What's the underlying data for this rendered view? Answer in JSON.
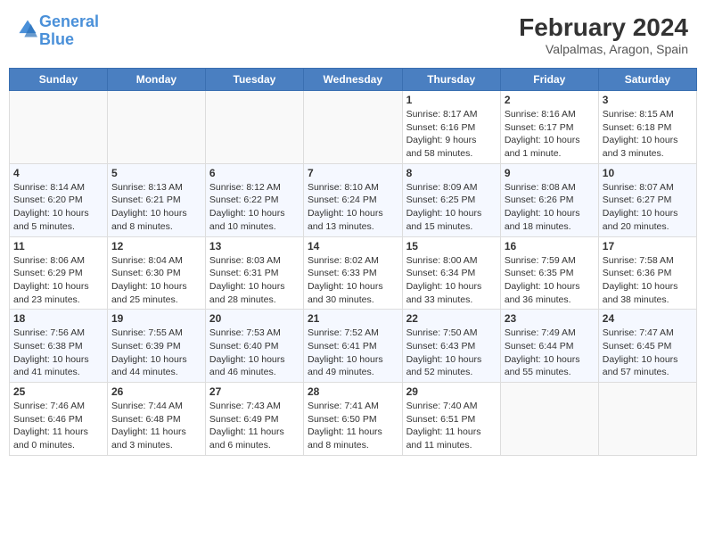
{
  "header": {
    "logo_text_general": "General",
    "logo_text_blue": "Blue",
    "month_title": "February 2024",
    "location": "Valpalmas, Aragon, Spain"
  },
  "days_of_week": [
    "Sunday",
    "Monday",
    "Tuesday",
    "Wednesday",
    "Thursday",
    "Friday",
    "Saturday"
  ],
  "weeks": [
    [
      {
        "date": "",
        "lines": []
      },
      {
        "date": "",
        "lines": []
      },
      {
        "date": "",
        "lines": []
      },
      {
        "date": "",
        "lines": []
      },
      {
        "date": "1",
        "lines": [
          "Sunrise: 8:17 AM",
          "Sunset: 6:16 PM",
          "Daylight: 9 hours",
          "and 58 minutes."
        ]
      },
      {
        "date": "2",
        "lines": [
          "Sunrise: 8:16 AM",
          "Sunset: 6:17 PM",
          "Daylight: 10 hours",
          "and 1 minute."
        ]
      },
      {
        "date": "3",
        "lines": [
          "Sunrise: 8:15 AM",
          "Sunset: 6:18 PM",
          "Daylight: 10 hours",
          "and 3 minutes."
        ]
      }
    ],
    [
      {
        "date": "4",
        "lines": [
          "Sunrise: 8:14 AM",
          "Sunset: 6:20 PM",
          "Daylight: 10 hours",
          "and 5 minutes."
        ]
      },
      {
        "date": "5",
        "lines": [
          "Sunrise: 8:13 AM",
          "Sunset: 6:21 PM",
          "Daylight: 10 hours",
          "and 8 minutes."
        ]
      },
      {
        "date": "6",
        "lines": [
          "Sunrise: 8:12 AM",
          "Sunset: 6:22 PM",
          "Daylight: 10 hours",
          "and 10 minutes."
        ]
      },
      {
        "date": "7",
        "lines": [
          "Sunrise: 8:10 AM",
          "Sunset: 6:24 PM",
          "Daylight: 10 hours",
          "and 13 minutes."
        ]
      },
      {
        "date": "8",
        "lines": [
          "Sunrise: 8:09 AM",
          "Sunset: 6:25 PM",
          "Daylight: 10 hours",
          "and 15 minutes."
        ]
      },
      {
        "date": "9",
        "lines": [
          "Sunrise: 8:08 AM",
          "Sunset: 6:26 PM",
          "Daylight: 10 hours",
          "and 18 minutes."
        ]
      },
      {
        "date": "10",
        "lines": [
          "Sunrise: 8:07 AM",
          "Sunset: 6:27 PM",
          "Daylight: 10 hours",
          "and 20 minutes."
        ]
      }
    ],
    [
      {
        "date": "11",
        "lines": [
          "Sunrise: 8:06 AM",
          "Sunset: 6:29 PM",
          "Daylight: 10 hours",
          "and 23 minutes."
        ]
      },
      {
        "date": "12",
        "lines": [
          "Sunrise: 8:04 AM",
          "Sunset: 6:30 PM",
          "Daylight: 10 hours",
          "and 25 minutes."
        ]
      },
      {
        "date": "13",
        "lines": [
          "Sunrise: 8:03 AM",
          "Sunset: 6:31 PM",
          "Daylight: 10 hours",
          "and 28 minutes."
        ]
      },
      {
        "date": "14",
        "lines": [
          "Sunrise: 8:02 AM",
          "Sunset: 6:33 PM",
          "Daylight: 10 hours",
          "and 30 minutes."
        ]
      },
      {
        "date": "15",
        "lines": [
          "Sunrise: 8:00 AM",
          "Sunset: 6:34 PM",
          "Daylight: 10 hours",
          "and 33 minutes."
        ]
      },
      {
        "date": "16",
        "lines": [
          "Sunrise: 7:59 AM",
          "Sunset: 6:35 PM",
          "Daylight: 10 hours",
          "and 36 minutes."
        ]
      },
      {
        "date": "17",
        "lines": [
          "Sunrise: 7:58 AM",
          "Sunset: 6:36 PM",
          "Daylight: 10 hours",
          "and 38 minutes."
        ]
      }
    ],
    [
      {
        "date": "18",
        "lines": [
          "Sunrise: 7:56 AM",
          "Sunset: 6:38 PM",
          "Daylight: 10 hours",
          "and 41 minutes."
        ]
      },
      {
        "date": "19",
        "lines": [
          "Sunrise: 7:55 AM",
          "Sunset: 6:39 PM",
          "Daylight: 10 hours",
          "and 44 minutes."
        ]
      },
      {
        "date": "20",
        "lines": [
          "Sunrise: 7:53 AM",
          "Sunset: 6:40 PM",
          "Daylight: 10 hours",
          "and 46 minutes."
        ]
      },
      {
        "date": "21",
        "lines": [
          "Sunrise: 7:52 AM",
          "Sunset: 6:41 PM",
          "Daylight: 10 hours",
          "and 49 minutes."
        ]
      },
      {
        "date": "22",
        "lines": [
          "Sunrise: 7:50 AM",
          "Sunset: 6:43 PM",
          "Daylight: 10 hours",
          "and 52 minutes."
        ]
      },
      {
        "date": "23",
        "lines": [
          "Sunrise: 7:49 AM",
          "Sunset: 6:44 PM",
          "Daylight: 10 hours",
          "and 55 minutes."
        ]
      },
      {
        "date": "24",
        "lines": [
          "Sunrise: 7:47 AM",
          "Sunset: 6:45 PM",
          "Daylight: 10 hours",
          "and 57 minutes."
        ]
      }
    ],
    [
      {
        "date": "25",
        "lines": [
          "Sunrise: 7:46 AM",
          "Sunset: 6:46 PM",
          "Daylight: 11 hours",
          "and 0 minutes."
        ]
      },
      {
        "date": "26",
        "lines": [
          "Sunrise: 7:44 AM",
          "Sunset: 6:48 PM",
          "Daylight: 11 hours",
          "and 3 minutes."
        ]
      },
      {
        "date": "27",
        "lines": [
          "Sunrise: 7:43 AM",
          "Sunset: 6:49 PM",
          "Daylight: 11 hours",
          "and 6 minutes."
        ]
      },
      {
        "date": "28",
        "lines": [
          "Sunrise: 7:41 AM",
          "Sunset: 6:50 PM",
          "Daylight: 11 hours",
          "and 8 minutes."
        ]
      },
      {
        "date": "29",
        "lines": [
          "Sunrise: 7:40 AM",
          "Sunset: 6:51 PM",
          "Daylight: 11 hours",
          "and 11 minutes."
        ]
      },
      {
        "date": "",
        "lines": []
      },
      {
        "date": "",
        "lines": []
      }
    ]
  ]
}
